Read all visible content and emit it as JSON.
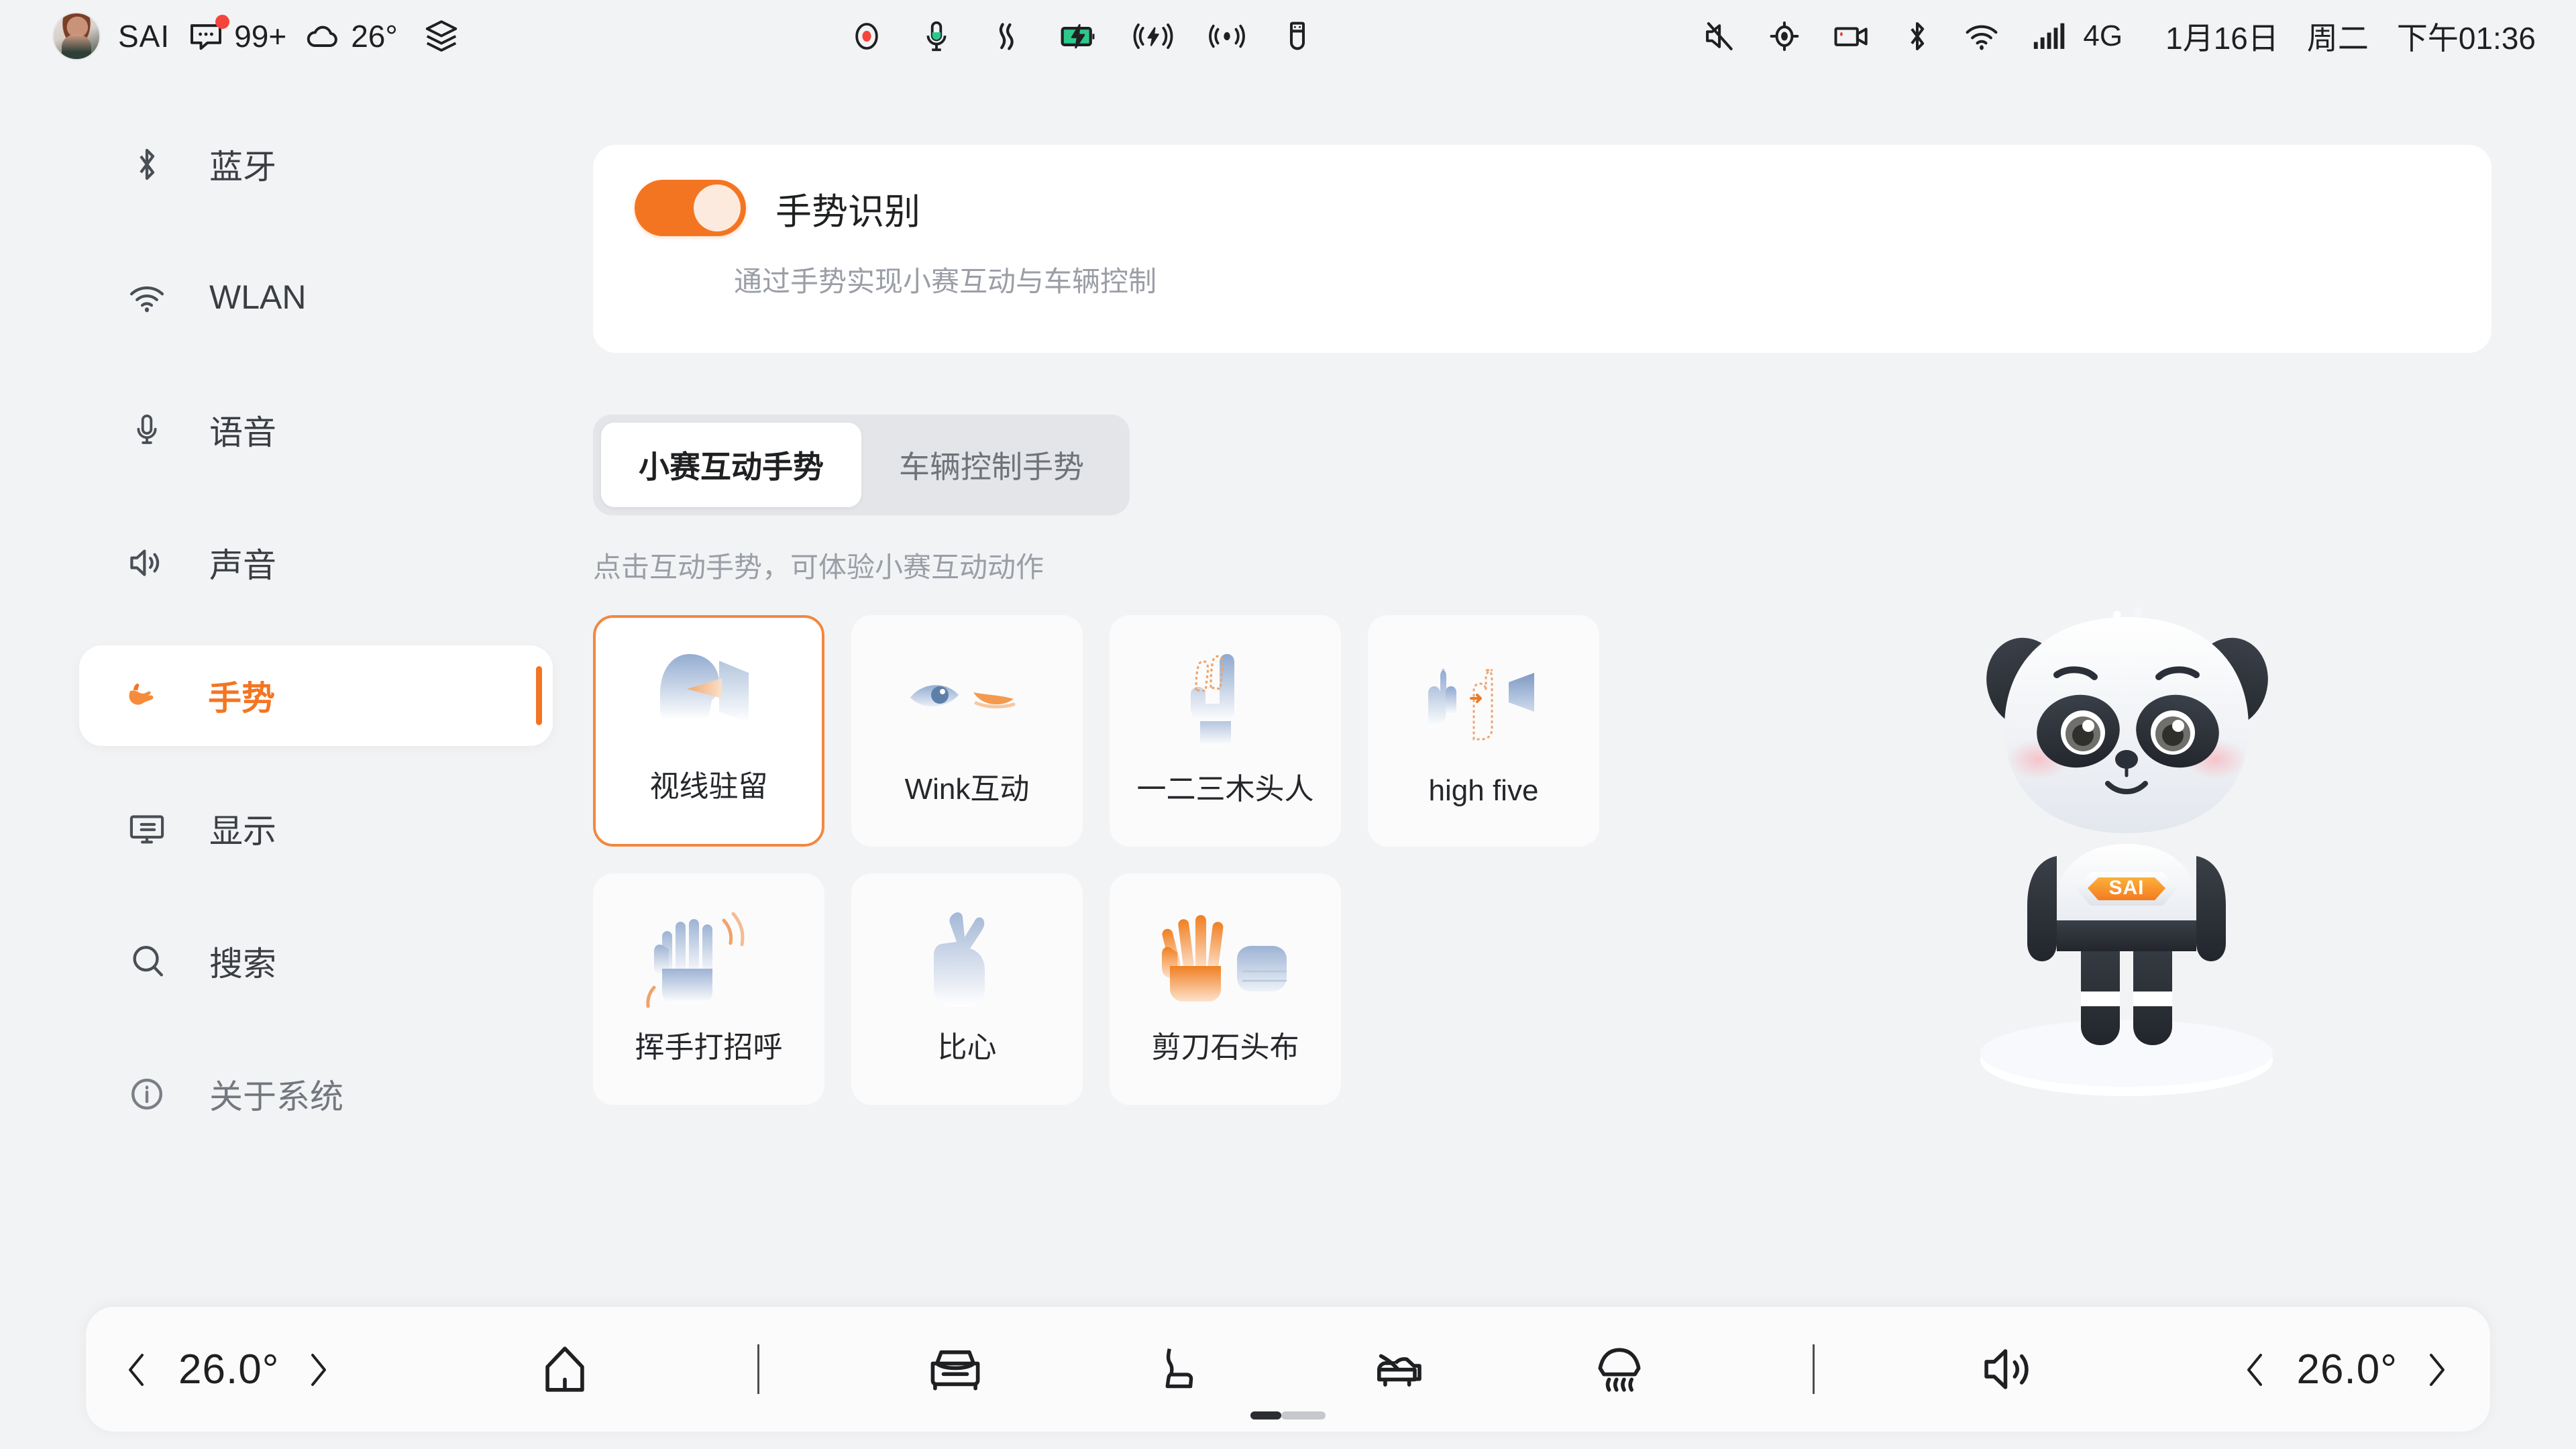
{
  "statusbar": {
    "user_name": "SAI",
    "messages_count": "99+",
    "weather_temp": "26°",
    "time": "下午01:36",
    "date": "1月16日",
    "weekday": "周二",
    "network_type": "4G",
    "icons_left": [
      "avatar",
      "message-icon",
      "cloud-icon",
      "layers-icon"
    ],
    "icons_center": [
      "record-icon",
      "microphone-icon",
      "air-flow-icon",
      "battery-charging-icon",
      "wireless-charge-icon",
      "signal-broadcast-icon",
      "usb-icon"
    ],
    "icons_right": [
      "mute-icon",
      "location-icon",
      "dashcam-icon",
      "bluetooth-icon",
      "wifi-icon",
      "cellular-signal-icon"
    ],
    "accent_red": "#f4443c",
    "battery_green": "#2dc98a"
  },
  "sidebar": {
    "items": [
      {
        "label": "蓝牙",
        "icon": "bluetooth-icon",
        "active": false
      },
      {
        "label": "WLAN",
        "icon": "wifi-icon",
        "active": false
      },
      {
        "label": "语音",
        "icon": "microphone-icon",
        "active": false
      },
      {
        "label": "声音",
        "icon": "speaker-icon",
        "active": false
      },
      {
        "label": "手势",
        "icon": "hand-pointer-icon",
        "active": true
      },
      {
        "label": "显示",
        "icon": "display-icon",
        "active": false
      },
      {
        "label": "搜索",
        "icon": "search-icon",
        "active": false
      },
      {
        "label": "关于系统",
        "icon": "info-icon",
        "active": false
      }
    ],
    "active_color": "#f47521"
  },
  "main": {
    "toggle": {
      "title": "手势识别",
      "subtitle": "通过手势实现小赛互动与车辆控制",
      "state_on": true,
      "on_color": "#f47521"
    },
    "tabs": [
      {
        "label": "小赛互动手势",
        "selected": true
      },
      {
        "label": "车辆控制手势",
        "selected": false
      }
    ],
    "hint": "点击互动手势，可体验小赛互动动作",
    "gesture_cards": [
      {
        "label": "视线驻留",
        "art": "gaze-dwell-art",
        "selected": true
      },
      {
        "label": "Wink互动",
        "art": "wink-eye-art",
        "selected": false
      },
      {
        "label": "一二三木头人",
        "art": "two-finger-art",
        "selected": false
      },
      {
        "label": "high five",
        "art": "high-five-art",
        "selected": false
      },
      {
        "label": "挥手打招呼",
        "art": "waving-hand-art",
        "selected": false
      },
      {
        "label": "比心",
        "art": "finger-heart-art",
        "selected": false
      },
      {
        "label": "剪刀石头布",
        "art": "rock-paper-scissors-art",
        "selected": false
      }
    ],
    "selected_border_color": "#f2883f"
  },
  "mascot": {
    "name": "SAI",
    "chest_logo": "SAI",
    "logo_color": "#f7941d"
  },
  "dock": {
    "left_temp": "26.0°",
    "right_temp": "26.0°",
    "prev_label": "‹",
    "next_label": "›",
    "icons": [
      "home-icon",
      "car-icon",
      "seat-icon",
      "trunk-icon",
      "defrost-icon",
      "volume-icon"
    ],
    "page_indicator": {
      "current": 1,
      "total": 2
    }
  }
}
